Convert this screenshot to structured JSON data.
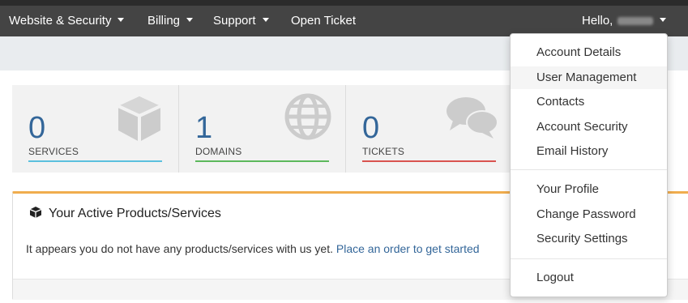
{
  "nav": {
    "items": [
      {
        "label": "Website & Security"
      },
      {
        "label": "Billing"
      },
      {
        "label": "Support"
      },
      {
        "label": "Open Ticket"
      }
    ],
    "greeting": "Hello,"
  },
  "tiles": [
    {
      "count": "0",
      "label": "SERVICES",
      "color": "#5bc0de",
      "icon": "cube-icon"
    },
    {
      "count": "1",
      "label": "DOMAINS",
      "color": "#5cb85c",
      "icon": "globe-icon"
    },
    {
      "count": "0",
      "label": "TICKETS",
      "color": "#d9534f",
      "icon": "comments-icon"
    }
  ],
  "panel": {
    "title": "Your Active Products/Services",
    "message": "It appears you do not have any products/services with us yet.",
    "link": "Place an order to get started",
    "accent": "#f0ad4e"
  },
  "dropdown": {
    "items": [
      "Account Details",
      "User Management",
      "Contacts",
      "Account Security",
      "Email History",
      "Your Profile",
      "Change Password",
      "Security Settings",
      "Logout"
    ]
  },
  "colors": {
    "navbar": "#444444",
    "link": "#336699"
  }
}
